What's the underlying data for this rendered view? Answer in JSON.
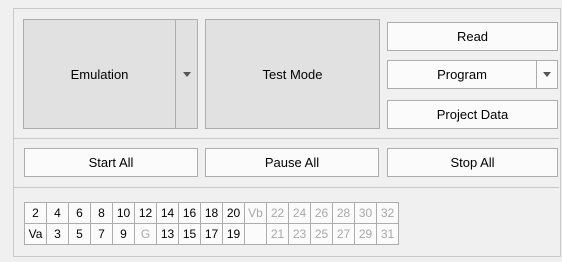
{
  "emulation": {
    "label": "Emulation"
  },
  "test_mode": {
    "label": "Test Mode"
  },
  "read": {
    "label": "Read"
  },
  "program": {
    "label": "Program"
  },
  "project_data": {
    "label": "Project Data"
  },
  "start_all": {
    "label": "Start All"
  },
  "pause_all": {
    "label": "Pause All"
  },
  "stop_all": {
    "label": "Stop All"
  },
  "channels": {
    "row1": [
      {
        "label": "2",
        "enabled": true
      },
      {
        "label": "4",
        "enabled": true
      },
      {
        "label": "6",
        "enabled": true
      },
      {
        "label": "8",
        "enabled": true
      },
      {
        "label": "10",
        "enabled": true
      },
      {
        "label": "12",
        "enabled": true
      },
      {
        "label": "14",
        "enabled": true
      },
      {
        "label": "16",
        "enabled": true
      },
      {
        "label": "18",
        "enabled": true
      },
      {
        "label": "20",
        "enabled": true
      },
      {
        "label": "Vb",
        "enabled": false
      },
      {
        "label": "22",
        "enabled": false
      },
      {
        "label": "24",
        "enabled": false
      },
      {
        "label": "26",
        "enabled": false
      },
      {
        "label": "28",
        "enabled": false
      },
      {
        "label": "30",
        "enabled": false
      },
      {
        "label": "32",
        "enabled": false
      }
    ],
    "row2": [
      {
        "label": "Va",
        "enabled": true
      },
      {
        "label": "3",
        "enabled": true
      },
      {
        "label": "5",
        "enabled": true
      },
      {
        "label": "7",
        "enabled": true
      },
      {
        "label": "9",
        "enabled": true
      },
      {
        "label": "G",
        "enabled": false
      },
      {
        "label": "13",
        "enabled": true
      },
      {
        "label": "15",
        "enabled": true
      },
      {
        "label": "17",
        "enabled": true
      },
      {
        "label": "19",
        "enabled": true
      },
      {
        "label": "",
        "enabled": false
      },
      {
        "label": "21",
        "enabled": false
      },
      {
        "label": "23",
        "enabled": false
      },
      {
        "label": "25",
        "enabled": false
      },
      {
        "label": "27",
        "enabled": false
      },
      {
        "label": "29",
        "enabled": false
      },
      {
        "label": "31",
        "enabled": false
      }
    ]
  }
}
